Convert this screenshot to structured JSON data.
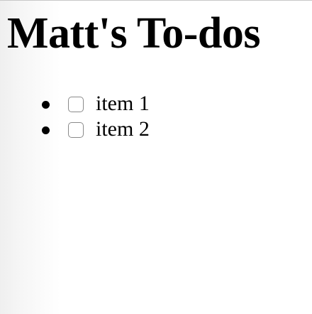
{
  "page": {
    "title": "Matt's To-dos"
  },
  "todos": [
    {
      "label": "item 1",
      "checked": false
    },
    {
      "label": "item 2",
      "checked": false
    }
  ]
}
